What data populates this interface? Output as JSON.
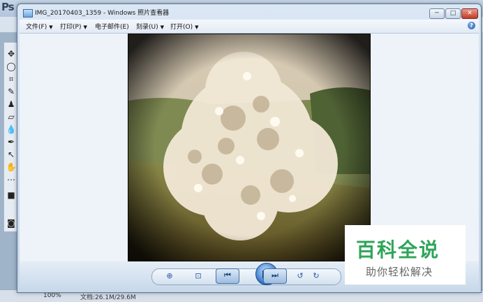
{
  "background_app": {
    "logo": "Ps",
    "status_zoom": "100%",
    "status_doc": "文档:26.1M/29.6M",
    "tools": [
      "move-tool",
      "lasso-tool",
      "crop-tool",
      "heal-tool",
      "stamp-tool",
      "eraser-tool",
      "blur-tool",
      "pen-tool",
      "select-tool",
      "hand-tool",
      "more-tool"
    ]
  },
  "window": {
    "title": "IMG_20170403_1359 - Windows 照片查看器",
    "minimize": "─",
    "maximize": "□",
    "close": "✕"
  },
  "menu": {
    "items": [
      {
        "label": "文件(F)"
      },
      {
        "label": "打印(P)"
      },
      {
        "label": "电子邮件(E)"
      },
      {
        "label": "刻录(U)"
      },
      {
        "label": "打开(O)"
      }
    ],
    "help": "?"
  },
  "controls": {
    "zoom": "⊕",
    "fit": "⊡",
    "prev": "⏮",
    "next": "⏭",
    "rotate_ccw": "↺",
    "rotate_cw": "↻",
    "delete": "✕"
  },
  "watermark": {
    "title": "百科全说",
    "subtitle": "助你轻松解决"
  }
}
